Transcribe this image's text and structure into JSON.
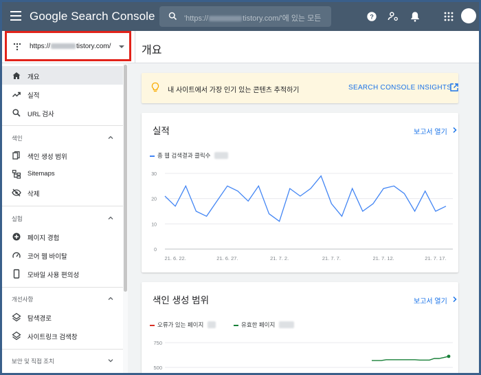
{
  "app": {
    "title": "Google Search Console",
    "search_placeholder_prefix": "'https://",
    "search_placeholder_suffix": "tistory.com/'에 있는 모든"
  },
  "property": {
    "url_prefix": "https://",
    "url_suffix": "tistory.com/"
  },
  "page": {
    "title": "개요"
  },
  "sidebar": {
    "overview": "개요",
    "performance": "실적",
    "url_inspection": "URL 검사",
    "index_section": "색인",
    "coverage": "색인 생성 범위",
    "sitemaps": "Sitemaps",
    "removals": "삭제",
    "experience_section": "실험",
    "page_experience": "페이지 경험",
    "core_web_vitals": "코어 웹 바이탈",
    "mobile_usability": "모바일 사용 편의성",
    "enhancements_section": "개선사항",
    "breadcrumbs": "탐색경로",
    "sitelinks_searchbox": "사이트링크 검색창",
    "security_section": "보안 및 직접 조치"
  },
  "insights": {
    "text": "내 사이트에서 가장 인기 있는 콘텐츠 추적하기",
    "link": "SEARCH CONSOLE INSIGHTS"
  },
  "performance_card": {
    "title": "실적",
    "open_report": "보고서 열기",
    "legend": "총 웹 검색결과 클릭수"
  },
  "coverage_card": {
    "title": "색인 생성 범위",
    "open_report": "보고서 열기",
    "legend_errors": "오류가 있는 페이지",
    "legend_valid": "유효한 페이지"
  },
  "colors": {
    "topbar": "#465a6e",
    "accent": "#1a73e8",
    "clicks_line": "#4285f4",
    "error": "#d93025",
    "valid": "#188038",
    "highlight_box": "#e2231a"
  },
  "chart_data": [
    {
      "type": "line",
      "series": [
        {
          "name": "총 웹 검색결과 클릭수",
          "x": [
            "21. 6. 21.",
            "21. 6. 22.",
            "21. 6. 23.",
            "21. 6. 24.",
            "21. 6. 25.",
            "21. 6. 26.",
            "21. 6. 27.",
            "21. 6. 28.",
            "21. 6. 29.",
            "21. 6. 30.",
            "21. 7. 1.",
            "21. 7. 2.",
            "21. 7. 3.",
            "21. 7. 4.",
            "21. 7. 5.",
            "21. 7. 6.",
            "21. 7. 7.",
            "21. 7. 8.",
            "21. 7. 9.",
            "21. 7. 10.",
            "21. 7. 11.",
            "21. 7. 12.",
            "21. 7. 13.",
            "21. 7. 14.",
            "21. 7. 15.",
            "21. 7. 16.",
            "21. 7. 17.",
            "21. 7. 18."
          ],
          "values": [
            21,
            17,
            25,
            15,
            13,
            19,
            25,
            23,
            19,
            25,
            14,
            11,
            24,
            21,
            24,
            29,
            18,
            13,
            24,
            15,
            18,
            24,
            25,
            22,
            15,
            23,
            15,
            17
          ]
        }
      ],
      "x_ticks": [
        "21. 6. 22.",
        "21. 6. 27.",
        "21. 7. 2.",
        "21. 7. 7.",
        "21. 7. 12.",
        "21. 7. 17."
      ],
      "y_ticks": [
        "0",
        "10",
        "20",
        "30"
      ],
      "ylim": [
        0,
        30
      ],
      "grid": true,
      "legend": "top-left"
    },
    {
      "type": "line",
      "series": [
        {
          "name": "유효한 페이지",
          "values": [
            570,
            570,
            570,
            578,
            578,
            578,
            578,
            578,
            578,
            578,
            574,
            574,
            574,
            590,
            590,
            600,
            612
          ]
        }
      ],
      "y_ticks": [
        "750",
        "500"
      ],
      "ylim": [
        500,
        750
      ],
      "grid": true,
      "legend": "top-left"
    }
  ]
}
